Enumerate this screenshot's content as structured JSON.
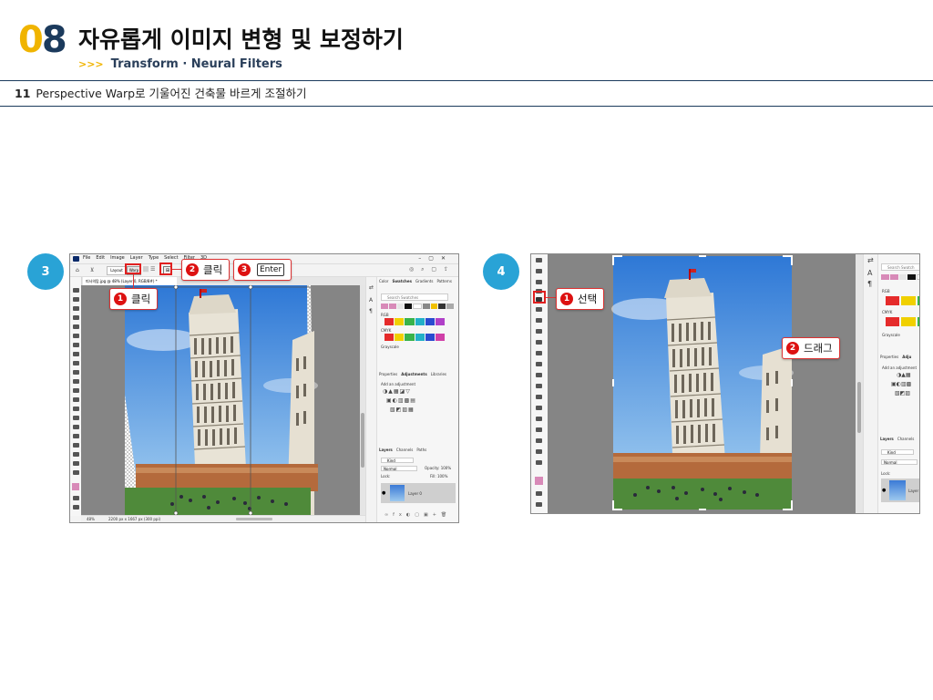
{
  "chapter": {
    "number_first": "0",
    "number_second": "8",
    "title": "자유롭게 이미지 변형 및 보정하기",
    "subtitle_arrows": ">>>",
    "subtitle": "Transform · Neural Filters"
  },
  "section": {
    "number": "11",
    "title": "Perspective Warp로 기울어진 건축물 바르게 조절하기"
  },
  "steps": [
    {
      "label": "3",
      "menu": [
        "File",
        "Edit",
        "Image",
        "Layer",
        "Type",
        "Select",
        "Filter",
        "3D"
      ],
      "options_bar": {
        "layout_label": "Layout",
        "warp_label": "Warp"
      },
      "tab_title": "피사의탑.jpg @ 48% (Layer 0, RGB/8#) *",
      "status_zoom": "48%",
      "status_info": "2200 px x 1667 px (300 ppi)",
      "callouts": [
        {
          "num": "1",
          "text": "클릭"
        },
        {
          "num": "2",
          "text": "클릭"
        },
        {
          "num": "3",
          "key": "Enter"
        }
      ],
      "panels": {
        "tabs_top": [
          "Color",
          "Swatches",
          "Gradients",
          "Patterns"
        ],
        "search_placeholder": "Search Swatches",
        "groups": [
          "RGB",
          "CMYK",
          "Grayscale"
        ],
        "tabs_mid": [
          "Properties",
          "Adjustments",
          "Libraries"
        ],
        "add_adjustment": "Add an adjustment",
        "tabs_bottom": [
          "Layers",
          "Channels",
          "Paths"
        ],
        "kind": "Kind",
        "blend_mode": "Normal",
        "opacity": "Opacity: 100%",
        "lock": "Lock:",
        "fill": "Fill: 100%",
        "layer_name": "Layer 0"
      }
    },
    {
      "label": "4",
      "callouts": [
        {
          "num": "1",
          "text": "선택"
        },
        {
          "num": "2",
          "text": "드래그"
        }
      ],
      "panels": {
        "search_placeholder": "Search Swatch",
        "groups": [
          "RGB",
          "CMYK",
          "Grayscale"
        ],
        "tabs_mid": [
          "Properties",
          "Adju"
        ],
        "add_adjustment": "Add an adjustment",
        "tabs_bottom": [
          "Layers",
          "Channels"
        ],
        "kind": "Kind",
        "blend_mode": "Normal",
        "lock": "Lock:",
        "layer_name": "Layer"
      }
    }
  ],
  "colors": {
    "accent_yellow": "#f0b400",
    "navy": "#1b3a5c",
    "step_blue": "#29a3d6",
    "callout_red": "#d11111"
  }
}
